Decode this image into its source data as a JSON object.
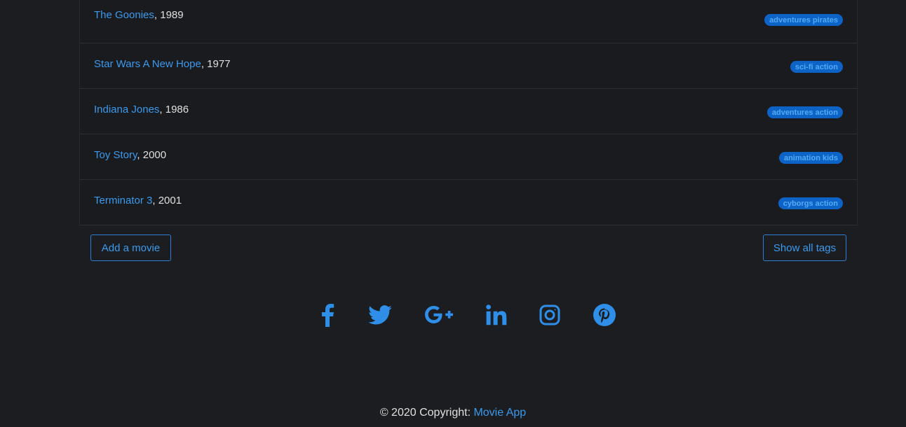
{
  "movies": [
    {
      "title": "The Goonies",
      "year": ", 1989",
      "tags": "adventures pirates"
    },
    {
      "title": "Star Wars A New Hope",
      "year": ", 1977",
      "tags": "sci-fi action"
    },
    {
      "title": "Indiana Jones",
      "year": ", 1986",
      "tags": "adventures action"
    },
    {
      "title": "Toy Story",
      "year": ", 2000",
      "tags": "animation kids"
    },
    {
      "title": "Terminator 3",
      "year": ", 2001",
      "tags": "cyborgs action"
    }
  ],
  "actions": {
    "add_movie": "Add a movie",
    "show_all_tags": "Show all tags"
  },
  "social": {
    "icons": [
      "facebook-icon",
      "twitter-icon",
      "google-plus-icon",
      "linkedin-icon",
      "instagram-icon",
      "pinterest-icon"
    ]
  },
  "footer": {
    "copyright": "© 2020 Copyright: ",
    "app_name": "Movie App"
  },
  "colors": {
    "background": "#1b1d20",
    "accent": "#3b9aee",
    "badge_bg": "#0e63c7",
    "badge_text": "#55aaf4"
  }
}
